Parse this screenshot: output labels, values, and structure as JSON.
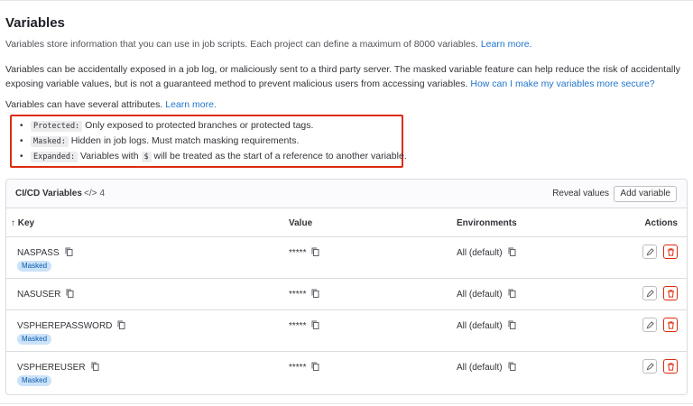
{
  "page": {
    "title": "Variables",
    "subtitle_text": "Variables store information that you can use in job scripts. Each project can define a maximum of 8000 variables.",
    "subtitle_link": "Learn more.",
    "warning_text": "Variables can be accidentally exposed in a job log, or maliciously sent to a third party server. The masked variable feature can help reduce the risk of accidentally exposing variable values, but is not a guaranteed method to prevent malicious users from accessing variables.",
    "warning_link": "How can I make my variables more secure?",
    "attributes_text": "Variables can have several attributes.",
    "attributes_link": "Learn more."
  },
  "attributes": [
    {
      "code": "Protected:",
      "text": "Only exposed to protected branches or protected tags."
    },
    {
      "code": "Masked:",
      "text": "Hidden in job logs. Must match masking requirements."
    },
    {
      "code": "Expanded:",
      "text_before": "Variables with",
      "inline_code": "$",
      "text_after": "will be treated as the start of a reference to another variable."
    }
  ],
  "card": {
    "title": "CI/CD Variables",
    "count_icon": "code-icon",
    "count_icon_glyph": "</>",
    "count": "4",
    "reveal_label": "Reveal values",
    "add_label": "Add variable"
  },
  "table": {
    "headers": {
      "key": "↑ Key",
      "value": "Value",
      "environments": "Environments",
      "actions": "Actions"
    },
    "rows": [
      {
        "key": "NASPASS",
        "value": "*****",
        "env": "All (default)",
        "badge": "Masked"
      },
      {
        "key": "NASUSER",
        "value": "*****",
        "env": "All (default)",
        "badge": ""
      },
      {
        "key": "VSPHEREPASSWORD",
        "value": "*****",
        "env": "All (default)",
        "badge": "Masked"
      },
      {
        "key": "VSPHEREUSER",
        "value": "*****",
        "env": "All (default)",
        "badge": "Masked"
      }
    ]
  },
  "colors": {
    "link": "#1f75cb",
    "highlight_box": "#dd2b0e",
    "badge_bg": "#cbe2f9",
    "badge_text": "#0b5cad",
    "delete": "#dd2b0e"
  }
}
